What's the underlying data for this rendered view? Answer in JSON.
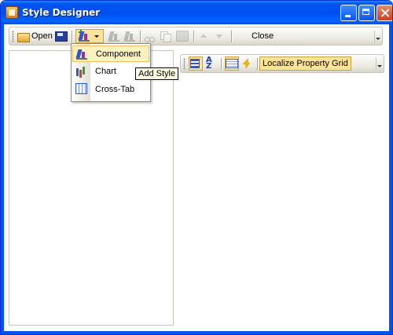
{
  "window": {
    "title": "Style Designer"
  },
  "toolbar": {
    "open_label": "Open",
    "close_label": "Close",
    "add_style_tooltip": "Add Style"
  },
  "add_style_menu": {
    "items": [
      {
        "label": "Component",
        "icon": "component-style-icon",
        "highlighted": true
      },
      {
        "label": "Chart",
        "icon": "chart-style-icon",
        "highlighted": false
      },
      {
        "label": "Cross-Tab",
        "icon": "crosstab-style-icon",
        "highlighted": false
      }
    ]
  },
  "property_grid_toolbar": {
    "localize_label": "Localize Property Grid"
  },
  "colors": {
    "title_bar": "#0055e5",
    "pressed_highlight": "#fbe39a",
    "menu_highlight": "#fdf0c2",
    "tooltip_bg": "#ffffe1"
  }
}
